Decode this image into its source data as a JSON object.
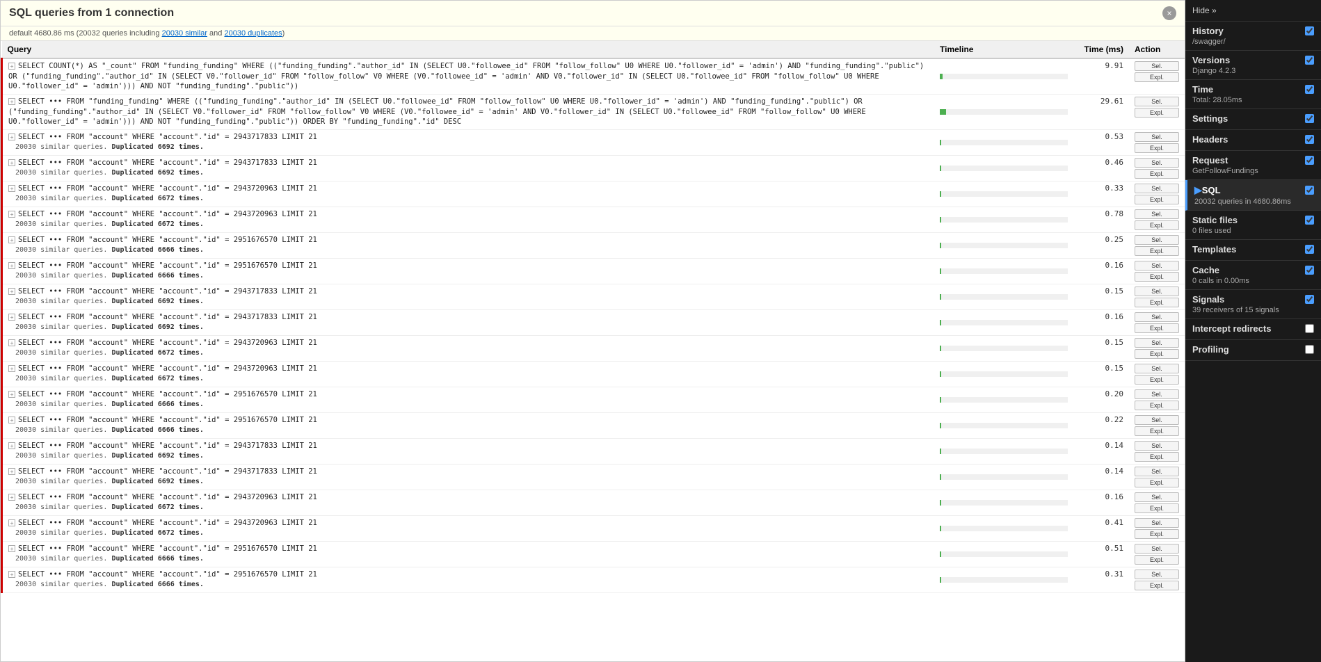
{
  "header": {
    "title": "SQL queries from 1 connection",
    "close_label": "×"
  },
  "summary": {
    "prefix": "default",
    "time": "4680.86 ms",
    "queries_count": "20032",
    "similar_text": "20030 similar",
    "duplicates_text": "20030 duplicates"
  },
  "table": {
    "col_query": "Query",
    "col_timeline": "Timeline",
    "col_time": "Time (ms)",
    "col_action": "Action",
    "btn_sel": "Sel.",
    "btn_expl": "Expl.",
    "rows": [
      {
        "sql": "SELECT COUNT(*) AS \"_count\" FROM \"funding_funding\" WHERE ((\"funding_funding\".\"author_id\" IN (SELECT U0.\"followee_id\" FROM \"follow_follow\" U0 WHERE U0.\"follower_id\" = 'admin') AND \"funding_funding\".\"public\") OR (\"funding_funding\".\"author_id\" IN (SELECT V0.\"follower_id\" FROM \"follow_follow\" V0 WHERE (V0.\"followee_id\" = 'admin' AND V0.\"follower_id\" IN (SELECT U0.\"followee_id\" FROM \"follow_follow\" U0 WHERE U0.\"follower_id\" = 'admin'))) AND NOT \"funding_funding\".\"public\"))",
        "time": "9.91",
        "timeline_pct": 2,
        "similar": "",
        "duplicated": ""
      },
      {
        "sql": "SELECT ••• FROM \"funding_funding\" WHERE ((\"funding_funding\".\"author_id\" IN (SELECT U0.\"followee_id\" FROM \"follow_follow\" U0 WHERE U0.\"follower_id\" = 'admin') AND \"funding_funding\".\"public\") OR (\"funding_funding\".\"author_id\" IN (SELECT V0.\"follower_id\" FROM \"follow_follow\" V0 WHERE (V0.\"followee_id\" = 'admin' AND V0.\"follower_id\" IN (SELECT U0.\"followee_id\" FROM \"follow_follow\" U0 WHERE U0.\"follower_id\" = 'admin'))) AND NOT \"funding_funding\".\"public\")) ORDER BY \"funding_funding\".\"id\" DESC",
        "time": "29.61",
        "timeline_pct": 5,
        "similar": "",
        "duplicated": ""
      },
      {
        "sql": "SELECT ••• FROM \"account\" WHERE \"account\".\"id\" = 2943717833 LIMIT 21",
        "time": "0.53",
        "timeline_pct": 1,
        "similar": "20030 similar queries.",
        "duplicated": "Duplicated 6692 times."
      },
      {
        "sql": "SELECT ••• FROM \"account\" WHERE \"account\".\"id\" = 2943717833 LIMIT 21",
        "time": "0.46",
        "timeline_pct": 1,
        "similar": "20030 similar queries.",
        "duplicated": "Duplicated 6692 times."
      },
      {
        "sql": "SELECT ••• FROM \"account\" WHERE \"account\".\"id\" = 2943720963 LIMIT 21",
        "time": "0.33",
        "timeline_pct": 1,
        "similar": "20030 similar queries.",
        "duplicated": "Duplicated 6672 times."
      },
      {
        "sql": "SELECT ••• FROM \"account\" WHERE \"account\".\"id\" = 2943720963 LIMIT 21",
        "time": "0.78",
        "timeline_pct": 1,
        "similar": "20030 similar queries.",
        "duplicated": "Duplicated 6672 times."
      },
      {
        "sql": "SELECT ••• FROM \"account\" WHERE \"account\".\"id\" = 2951676570 LIMIT 21",
        "time": "0.25",
        "timeline_pct": 1,
        "similar": "20030 similar queries.",
        "duplicated": "Duplicated 6666 times."
      },
      {
        "sql": "SELECT ••• FROM \"account\" WHERE \"account\".\"id\" = 2951676570 LIMIT 21",
        "time": "0.16",
        "timeline_pct": 1,
        "similar": "20030 similar queries.",
        "duplicated": "Duplicated 6666 times."
      },
      {
        "sql": "SELECT ••• FROM \"account\" WHERE \"account\".\"id\" = 2943717833 LIMIT 21",
        "time": "0.15",
        "timeline_pct": 1,
        "similar": "20030 similar queries.",
        "duplicated": "Duplicated 6692 times."
      },
      {
        "sql": "SELECT ••• FROM \"account\" WHERE \"account\".\"id\" = 2943717833 LIMIT 21",
        "time": "0.16",
        "timeline_pct": 1,
        "similar": "20030 similar queries.",
        "duplicated": "Duplicated 6692 times."
      },
      {
        "sql": "SELECT ••• FROM \"account\" WHERE \"account\".\"id\" = 2943720963 LIMIT 21",
        "time": "0.15",
        "timeline_pct": 1,
        "similar": "20030 similar queries.",
        "duplicated": "Duplicated 6672 times."
      },
      {
        "sql": "SELECT ••• FROM \"account\" WHERE \"account\".\"id\" = 2943720963 LIMIT 21",
        "time": "0.15",
        "timeline_pct": 1,
        "similar": "20030 similar queries.",
        "duplicated": "Duplicated 6672 times."
      },
      {
        "sql": "SELECT ••• FROM \"account\" WHERE \"account\".\"id\" = 2951676570 LIMIT 21",
        "time": "0.20",
        "timeline_pct": 1,
        "similar": "20030 similar queries.",
        "duplicated": "Duplicated 6666 times."
      },
      {
        "sql": "SELECT ••• FROM \"account\" WHERE \"account\".\"id\" = 2951676570 LIMIT 21",
        "time": "0.22",
        "timeline_pct": 1,
        "similar": "20030 similar queries.",
        "duplicated": "Duplicated 6666 times."
      },
      {
        "sql": "SELECT ••• FROM \"account\" WHERE \"account\".\"id\" = 2943717833 LIMIT 21",
        "time": "0.14",
        "timeline_pct": 1,
        "similar": "20030 similar queries.",
        "duplicated": "Duplicated 6692 times."
      },
      {
        "sql": "SELECT ••• FROM \"account\" WHERE \"account\".\"id\" = 2943717833 LIMIT 21",
        "time": "0.14",
        "timeline_pct": 1,
        "similar": "20030 similar queries.",
        "duplicated": "Duplicated 6692 times."
      },
      {
        "sql": "SELECT ••• FROM \"account\" WHERE \"account\".\"id\" = 2943720963 LIMIT 21",
        "time": "0.16",
        "timeline_pct": 1,
        "similar": "20030 similar queries.",
        "duplicated": "Duplicated 6672 times."
      },
      {
        "sql": "SELECT ••• FROM \"account\" WHERE \"account\".\"id\" = 2943720963 LIMIT 21",
        "time": "0.41",
        "timeline_pct": 1,
        "similar": "20030 similar queries.",
        "duplicated": "Duplicated 6672 times."
      },
      {
        "sql": "SELECT ••• FROM \"account\" WHERE \"account\".\"id\" = 2951676570 LIMIT 21",
        "time": "0.51",
        "timeline_pct": 1,
        "similar": "20030 similar queries.",
        "duplicated": "Duplicated 6666 times."
      },
      {
        "sql": "SELECT ••• FROM \"account\" WHERE \"account\".\"id\" = 2951676570 LIMIT 21",
        "time": "0.31",
        "timeline_pct": 1,
        "similar": "20030 similar queries.",
        "duplicated": "Duplicated 6666 times."
      }
    ]
  },
  "right_panel": {
    "hide_label": "Hide »",
    "sections": [
      {
        "id": "history",
        "title": "History",
        "subtitle": "/swagger/",
        "active": false,
        "checked": true
      },
      {
        "id": "versions",
        "title": "Versions",
        "subtitle": "Django 4.2.3",
        "active": false,
        "checked": true
      },
      {
        "id": "time",
        "title": "Time",
        "subtitle": "Total: 28.05ms",
        "active": false,
        "checked": true
      },
      {
        "id": "settings",
        "title": "Settings",
        "subtitle": "",
        "active": false,
        "checked": true
      },
      {
        "id": "headers",
        "title": "Headers",
        "subtitle": "",
        "active": false,
        "checked": true
      },
      {
        "id": "request",
        "title": "Request",
        "subtitle": "GetFollowFundings",
        "active": false,
        "checked": true
      },
      {
        "id": "sql",
        "title": "SQL",
        "subtitle": "20032 queries in 4680.86ms",
        "active": true,
        "checked": true
      },
      {
        "id": "static_files",
        "title": "Static files",
        "subtitle": "0 files used",
        "active": false,
        "checked": true
      },
      {
        "id": "templates",
        "title": "Templates",
        "subtitle": "",
        "active": false,
        "checked": true
      },
      {
        "id": "cache",
        "title": "Cache",
        "subtitle": "0 calls in 0.00ms",
        "active": false,
        "checked": true
      },
      {
        "id": "signals",
        "title": "Signals",
        "subtitle": "39 receivers of 15 signals",
        "active": false,
        "checked": true
      },
      {
        "id": "intercept_redirects",
        "title": "Intercept redirects",
        "subtitle": "",
        "active": false,
        "checked": false,
        "italic": true
      },
      {
        "id": "profiling",
        "title": "Profiling",
        "subtitle": "",
        "active": false,
        "checked": false,
        "italic": true
      }
    ]
  }
}
